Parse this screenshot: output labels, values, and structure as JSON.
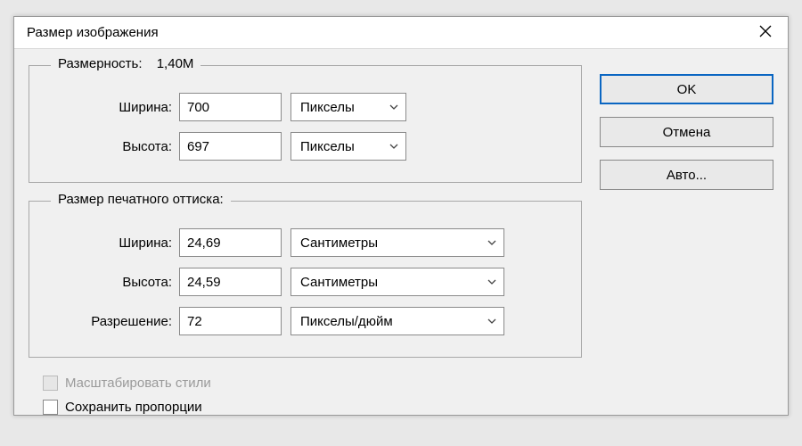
{
  "dialog": {
    "title": "Размер изображения",
    "close_icon": "×"
  },
  "dimensions": {
    "legend": "Размерность:",
    "size_value": "1,40M",
    "width_label": "Ширина:",
    "width_value": "700",
    "width_units": "Пикселы",
    "height_label": "Высота:",
    "height_value": "697",
    "height_units": "Пикселы"
  },
  "print": {
    "legend": "Размер печатного оттиска:",
    "width_label": "Ширина:",
    "width_value": "24,69",
    "width_units": "Сантиметры",
    "height_label": "Высота:",
    "height_value": "24,59",
    "height_units": "Сантиметры",
    "res_label": "Разрешение:",
    "res_value": "72",
    "res_units": "Пикселы/дюйм"
  },
  "options": {
    "scale_styles": "Масштабировать стили",
    "constrain": "Сохранить пропорции"
  },
  "buttons": {
    "ok": "OK",
    "cancel": "Отмена",
    "auto": "Авто..."
  }
}
